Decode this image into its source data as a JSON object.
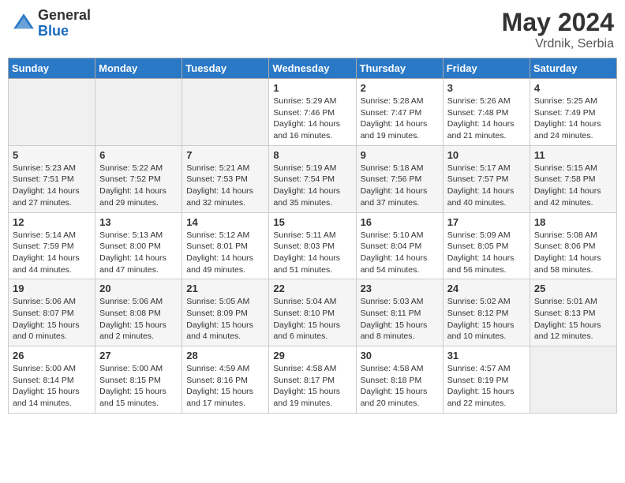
{
  "header": {
    "logo_general": "General",
    "logo_blue": "Blue",
    "month_year": "May 2024",
    "location": "Vrdnik, Serbia"
  },
  "weekdays": [
    "Sunday",
    "Monday",
    "Tuesday",
    "Wednesday",
    "Thursday",
    "Friday",
    "Saturday"
  ],
  "weeks": [
    [
      {
        "day": "",
        "content": ""
      },
      {
        "day": "",
        "content": ""
      },
      {
        "day": "",
        "content": ""
      },
      {
        "day": "1",
        "content": "Sunrise: 5:29 AM\nSunset: 7:46 PM\nDaylight: 14 hours and 16 minutes."
      },
      {
        "day": "2",
        "content": "Sunrise: 5:28 AM\nSunset: 7:47 PM\nDaylight: 14 hours and 19 minutes."
      },
      {
        "day": "3",
        "content": "Sunrise: 5:26 AM\nSunset: 7:48 PM\nDaylight: 14 hours and 21 minutes."
      },
      {
        "day": "4",
        "content": "Sunrise: 5:25 AM\nSunset: 7:49 PM\nDaylight: 14 hours and 24 minutes."
      }
    ],
    [
      {
        "day": "5",
        "content": "Sunrise: 5:23 AM\nSunset: 7:51 PM\nDaylight: 14 hours and 27 minutes."
      },
      {
        "day": "6",
        "content": "Sunrise: 5:22 AM\nSunset: 7:52 PM\nDaylight: 14 hours and 29 minutes."
      },
      {
        "day": "7",
        "content": "Sunrise: 5:21 AM\nSunset: 7:53 PM\nDaylight: 14 hours and 32 minutes."
      },
      {
        "day": "8",
        "content": "Sunrise: 5:19 AM\nSunset: 7:54 PM\nDaylight: 14 hours and 35 minutes."
      },
      {
        "day": "9",
        "content": "Sunrise: 5:18 AM\nSunset: 7:56 PM\nDaylight: 14 hours and 37 minutes."
      },
      {
        "day": "10",
        "content": "Sunrise: 5:17 AM\nSunset: 7:57 PM\nDaylight: 14 hours and 40 minutes."
      },
      {
        "day": "11",
        "content": "Sunrise: 5:15 AM\nSunset: 7:58 PM\nDaylight: 14 hours and 42 minutes."
      }
    ],
    [
      {
        "day": "12",
        "content": "Sunrise: 5:14 AM\nSunset: 7:59 PM\nDaylight: 14 hours and 44 minutes."
      },
      {
        "day": "13",
        "content": "Sunrise: 5:13 AM\nSunset: 8:00 PM\nDaylight: 14 hours and 47 minutes."
      },
      {
        "day": "14",
        "content": "Sunrise: 5:12 AM\nSunset: 8:01 PM\nDaylight: 14 hours and 49 minutes."
      },
      {
        "day": "15",
        "content": "Sunrise: 5:11 AM\nSunset: 8:03 PM\nDaylight: 14 hours and 51 minutes."
      },
      {
        "day": "16",
        "content": "Sunrise: 5:10 AM\nSunset: 8:04 PM\nDaylight: 14 hours and 54 minutes."
      },
      {
        "day": "17",
        "content": "Sunrise: 5:09 AM\nSunset: 8:05 PM\nDaylight: 14 hours and 56 minutes."
      },
      {
        "day": "18",
        "content": "Sunrise: 5:08 AM\nSunset: 8:06 PM\nDaylight: 14 hours and 58 minutes."
      }
    ],
    [
      {
        "day": "19",
        "content": "Sunrise: 5:06 AM\nSunset: 8:07 PM\nDaylight: 15 hours and 0 minutes."
      },
      {
        "day": "20",
        "content": "Sunrise: 5:06 AM\nSunset: 8:08 PM\nDaylight: 15 hours and 2 minutes."
      },
      {
        "day": "21",
        "content": "Sunrise: 5:05 AM\nSunset: 8:09 PM\nDaylight: 15 hours and 4 minutes."
      },
      {
        "day": "22",
        "content": "Sunrise: 5:04 AM\nSunset: 8:10 PM\nDaylight: 15 hours and 6 minutes."
      },
      {
        "day": "23",
        "content": "Sunrise: 5:03 AM\nSunset: 8:11 PM\nDaylight: 15 hours and 8 minutes."
      },
      {
        "day": "24",
        "content": "Sunrise: 5:02 AM\nSunset: 8:12 PM\nDaylight: 15 hours and 10 minutes."
      },
      {
        "day": "25",
        "content": "Sunrise: 5:01 AM\nSunset: 8:13 PM\nDaylight: 15 hours and 12 minutes."
      }
    ],
    [
      {
        "day": "26",
        "content": "Sunrise: 5:00 AM\nSunset: 8:14 PM\nDaylight: 15 hours and 14 minutes."
      },
      {
        "day": "27",
        "content": "Sunrise: 5:00 AM\nSunset: 8:15 PM\nDaylight: 15 hours and 15 minutes."
      },
      {
        "day": "28",
        "content": "Sunrise: 4:59 AM\nSunset: 8:16 PM\nDaylight: 15 hours and 17 minutes."
      },
      {
        "day": "29",
        "content": "Sunrise: 4:58 AM\nSunset: 8:17 PM\nDaylight: 15 hours and 19 minutes."
      },
      {
        "day": "30",
        "content": "Sunrise: 4:58 AM\nSunset: 8:18 PM\nDaylight: 15 hours and 20 minutes."
      },
      {
        "day": "31",
        "content": "Sunrise: 4:57 AM\nSunset: 8:19 PM\nDaylight: 15 hours and 22 minutes."
      },
      {
        "day": "",
        "content": ""
      }
    ]
  ]
}
